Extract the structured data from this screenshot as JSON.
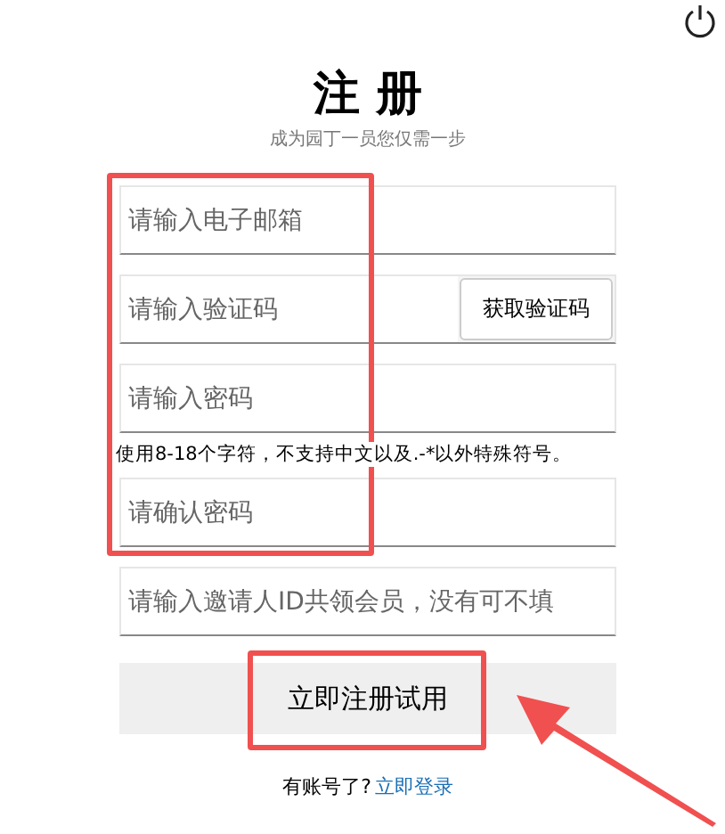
{
  "title": "注 册",
  "subtitle": "成为园丁一员您仅需一步",
  "fields": [
    {
      "kind": "input",
      "placeholder": "请输入电子邮箱"
    },
    {
      "kind": "code",
      "placeholder": "请输入验证码",
      "button": "获取验证码"
    },
    {
      "kind": "input",
      "placeholder": "请输入密码"
    },
    {
      "kind": "hint",
      "text": "使用8-18个字符，不支持中文以及.-*以外特殊符号。"
    },
    {
      "kind": "input",
      "placeholder": "请确认密码"
    },
    {
      "kind": "input",
      "placeholder": "请输入邀请人ID共领会员，没有可不填"
    }
  ],
  "submit": "立即注册试用",
  "footer": {
    "text": "有账号了?",
    "link": "立即登录"
  }
}
